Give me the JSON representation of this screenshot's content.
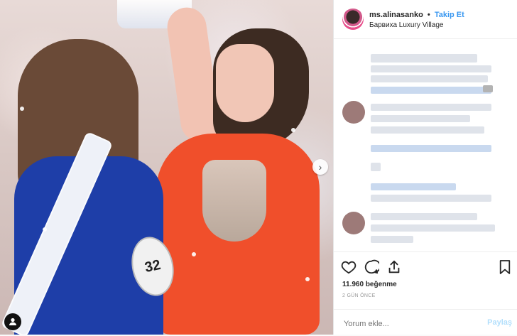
{
  "profile": {
    "username": "ms.alinasanko",
    "follow_label": "Takip Et",
    "location": "Барвиха Luxury Village"
  },
  "media": {
    "badge_text": "32",
    "next_icon": "chevron-right-icon",
    "tag_icon": "person-icon"
  },
  "actions": {
    "like_icon": "heart-icon",
    "comment_icon": "comment-icon",
    "share_icon": "share-icon",
    "save_icon": "bookmark-icon"
  },
  "stats": {
    "likes_text": "11.960 beğenme",
    "time_text": "2 GÜN ÖNCE"
  },
  "comment": {
    "placeholder": "Yorum ekle...",
    "post_label": "Paylaş"
  },
  "colors": {
    "follow": "#3897f0",
    "post_disabled": "#b2dffc",
    "dress": "#f04f2b"
  }
}
